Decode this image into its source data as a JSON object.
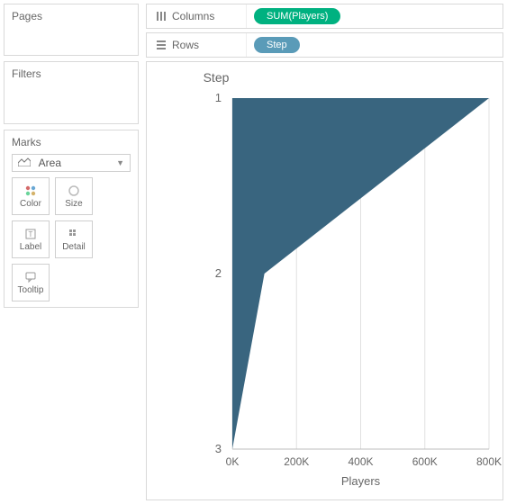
{
  "panels": {
    "pages_title": "Pages",
    "filters_title": "Filters",
    "marks_title": "Marks"
  },
  "marks": {
    "type_label": "Area",
    "cells": {
      "color": "Color",
      "size": "Size",
      "label": "Label",
      "detail": "Detail",
      "tooltip": "Tooltip"
    }
  },
  "shelves": {
    "columns_label": "Columns",
    "rows_label": "Rows",
    "columns_pill": "SUM(Players)",
    "rows_pill": "Step"
  },
  "chart_data": {
    "type": "area",
    "title": "Step",
    "xlabel": "Players",
    "ylabel": "",
    "x_ticks": [
      "0K",
      "200K",
      "400K",
      "600K",
      "800K"
    ],
    "y_ticks": [
      "1",
      "2",
      "3"
    ],
    "x_tick_values": [
      0,
      200000,
      400000,
      600000,
      800000
    ],
    "y_tick_values": [
      1,
      2,
      3
    ],
    "xlim": [
      0,
      800000
    ],
    "ylim": [
      3,
      1
    ],
    "series": [
      {
        "name": "Players",
        "points": [
          {
            "step": 1,
            "players": 800000
          },
          {
            "step": 2,
            "players": 100000
          },
          {
            "step": 3,
            "players": 0
          }
        ]
      }
    ],
    "fill_color": "#39657f"
  }
}
